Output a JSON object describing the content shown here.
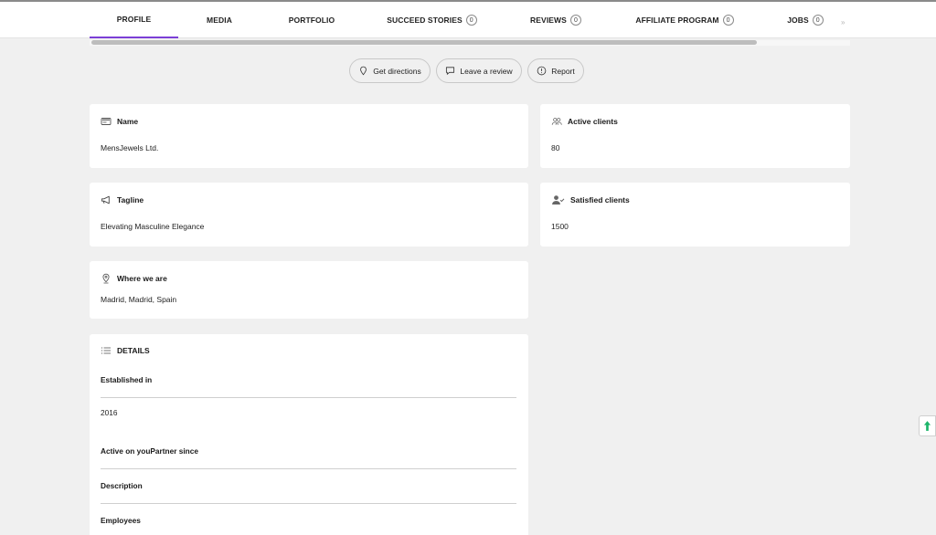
{
  "tabs": [
    {
      "label": "PROFILE"
    },
    {
      "label": "MEDIA"
    },
    {
      "label": "PORTFOLIO"
    },
    {
      "label": "SUCCEED STORIES",
      "count": "0"
    },
    {
      "label": "REVIEWS",
      "count": "0"
    },
    {
      "label": "AFFILIATE PROGRAM",
      "count": "0"
    },
    {
      "label": "JOBS",
      "count": "0"
    }
  ],
  "nav_more_arrow": "»",
  "actions": {
    "get_directions": "Get directions",
    "leave_review": "Leave a review",
    "report": "Report"
  },
  "cards": {
    "name": {
      "label": "Name",
      "value": "MensJewels Ltd."
    },
    "active_clients": {
      "label": "Active clients",
      "value": "80"
    },
    "tagline": {
      "label": "Tagline",
      "value": "Elevating Masculine Elegance"
    },
    "satisfied_clients": {
      "label": "Satisfied clients",
      "value": "1500"
    },
    "location": {
      "label": "Where we are",
      "value": "Madrid, Madrid, Spain"
    }
  },
  "details": {
    "title": "DETAILS",
    "established_label": "Established in",
    "established_value": "2016",
    "active_since_label": "Active on youPartner since",
    "description_label": "Description",
    "employees_label": "Employees"
  },
  "colors": {
    "accent": "#7b3fd6",
    "scroll_top_icon": "#1db56a",
    "background": "#f0f0f0"
  },
  "icons": {
    "directions": "map-pin-icon",
    "review": "chat-bubble-icon",
    "report": "info-circle-icon",
    "name": "id-card-icon",
    "active_clients": "users-icon",
    "tagline": "megaphone-icon",
    "satisfied_clients": "user-check-icon",
    "location": "map-pin-icon",
    "details": "list-icon",
    "scroll_top": "arrow-up-icon"
  }
}
